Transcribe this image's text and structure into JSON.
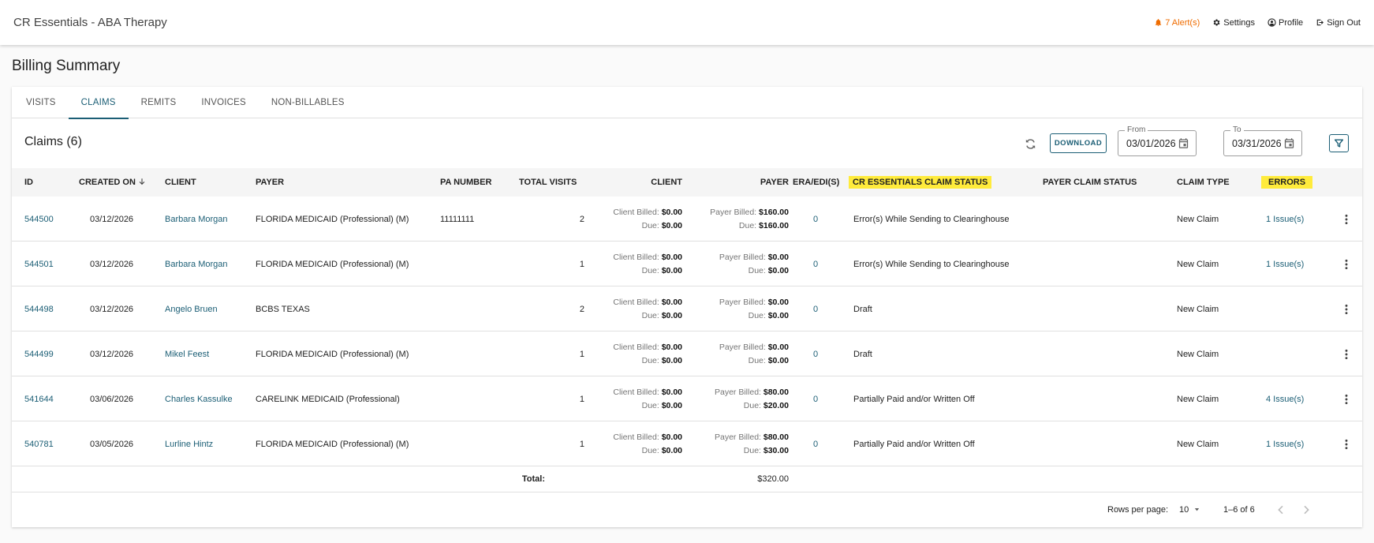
{
  "app": {
    "title": "CR Essentials - ABA Therapy"
  },
  "topnav": {
    "alerts": "7 Alert(s)",
    "settings": "Settings",
    "profile": "Profile",
    "signout": "Sign Out"
  },
  "page": {
    "title": "Billing Summary"
  },
  "tabs": [
    "VISITS",
    "CLAIMS",
    "REMITS",
    "INVOICES",
    "NON-BILLABLES"
  ],
  "claims": {
    "title": "Claims (6)",
    "download": "DOWNLOAD",
    "from_label": "From",
    "from_value": "03/01/2026",
    "to_label": "To",
    "to_value": "03/31/2026"
  },
  "columns": {
    "id": "ID",
    "created": "CREATED ON",
    "client": "CLIENT",
    "payer": "PAYER",
    "pa": "PA NUMBER",
    "visits": "TOTAL VISITS",
    "client_amt": "CLIENT",
    "payer_amt": "PAYER",
    "era": "ERA/EDI(S)",
    "cr_status": "CR ESSENTIALS CLAIM STATUS",
    "payer_status": "PAYER CLAIM STATUS",
    "type": "CLAIM TYPE",
    "errors": "ERRORS"
  },
  "labels": {
    "client_billed": "Client Billed:",
    "payer_billed": "Payer Billed:",
    "due": "Due:"
  },
  "rows": [
    {
      "id": "544500",
      "created": "03/12/2026",
      "client": "Barbara Morgan",
      "payer": "FLORIDA MEDICAID (Professional) (M)",
      "pa": "11111111",
      "visits": "2",
      "client_billed": "$0.00",
      "client_due": "$0.00",
      "payer_billed": "$160.00",
      "payer_due": "$160.00",
      "era": "0",
      "cr_status": "Error(s) While Sending to Clearinghouse",
      "payer_status": "",
      "type": "New Claim",
      "errors": "1 Issue(s)"
    },
    {
      "id": "544501",
      "created": "03/12/2026",
      "client": "Barbara Morgan",
      "payer": "FLORIDA MEDICAID (Professional) (M)",
      "pa": "",
      "visits": "1",
      "client_billed": "$0.00",
      "client_due": "$0.00",
      "payer_billed": "$0.00",
      "payer_due": "$0.00",
      "era": "0",
      "cr_status": "Error(s) While Sending to Clearinghouse",
      "payer_status": "",
      "type": "New Claim",
      "errors": "1 Issue(s)"
    },
    {
      "id": "544498",
      "created": "03/12/2026",
      "client": "Angelo Bruen",
      "payer": "BCBS TEXAS",
      "pa": "",
      "visits": "2",
      "client_billed": "$0.00",
      "client_due": "$0.00",
      "payer_billed": "$0.00",
      "payer_due": "$0.00",
      "era": "0",
      "cr_status": "Draft",
      "payer_status": "",
      "type": "New Claim",
      "errors": ""
    },
    {
      "id": "544499",
      "created": "03/12/2026",
      "client": "Mikel Feest",
      "payer": "FLORIDA MEDICAID (Professional) (M)",
      "pa": "",
      "visits": "1",
      "client_billed": "$0.00",
      "client_due": "$0.00",
      "payer_billed": "$0.00",
      "payer_due": "$0.00",
      "era": "0",
      "cr_status": "Draft",
      "payer_status": "",
      "type": "New Claim",
      "errors": ""
    },
    {
      "id": "541644",
      "created": "03/06/2026",
      "client": "Charles Kassulke",
      "payer": "CARELINK MEDICAID (Professional)",
      "pa": "",
      "visits": "1",
      "client_billed": "$0.00",
      "client_due": "$0.00",
      "payer_billed": "$80.00",
      "payer_due": "$20.00",
      "era": "0",
      "cr_status": "Partially Paid and/or Written Off",
      "payer_status": "",
      "type": "New Claim",
      "errors": "4 Issue(s)"
    },
    {
      "id": "540781",
      "created": "03/05/2026",
      "client": "Lurline Hintz",
      "payer": "FLORIDA MEDICAID (Professional) (M)",
      "pa": "",
      "visits": "1",
      "client_billed": "$0.00",
      "client_due": "$0.00",
      "payer_billed": "$80.00",
      "payer_due": "$30.00",
      "era": "0",
      "cr_status": "Partially Paid and/or Written Off",
      "payer_status": "",
      "type": "New Claim",
      "errors": "1 Issue(s)"
    }
  ],
  "total": {
    "label": "Total:",
    "payer_total": "$320.00"
  },
  "pagination": {
    "rows_label": "Rows per page:",
    "rows_value": "10",
    "range": "1–6 of 6"
  },
  "colors": {
    "accent": "#1b5e75",
    "alert": "#ef6c00",
    "highlight": "#ffeb3b"
  }
}
